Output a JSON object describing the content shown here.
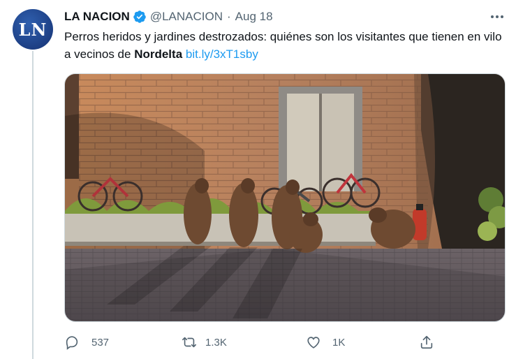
{
  "tweet": {
    "author": {
      "display_name": "LA NACION",
      "handle": "@LANACION",
      "avatar_initials": "LN",
      "verified": true
    },
    "separator": "·",
    "date": "Aug 18",
    "text": {
      "part1": "Perros heridos y jardines destrozados: quiénes son los visitantes que tienen en vilo a vecinos de ",
      "bold": "Nordelta",
      "space": " ",
      "link": "bit.ly/3xT1sby"
    },
    "media": {
      "icon": "photo-capybaras"
    },
    "actions": {
      "reply_count": "537",
      "retweet_count": "1.3K",
      "like_count": "1K"
    }
  },
  "colors": {
    "text_primary": "#0f1419",
    "text_secondary": "#536471",
    "link": "#1d9bf0",
    "verified": "#1d9bf0",
    "avatar_bg": "#1d3f84"
  }
}
